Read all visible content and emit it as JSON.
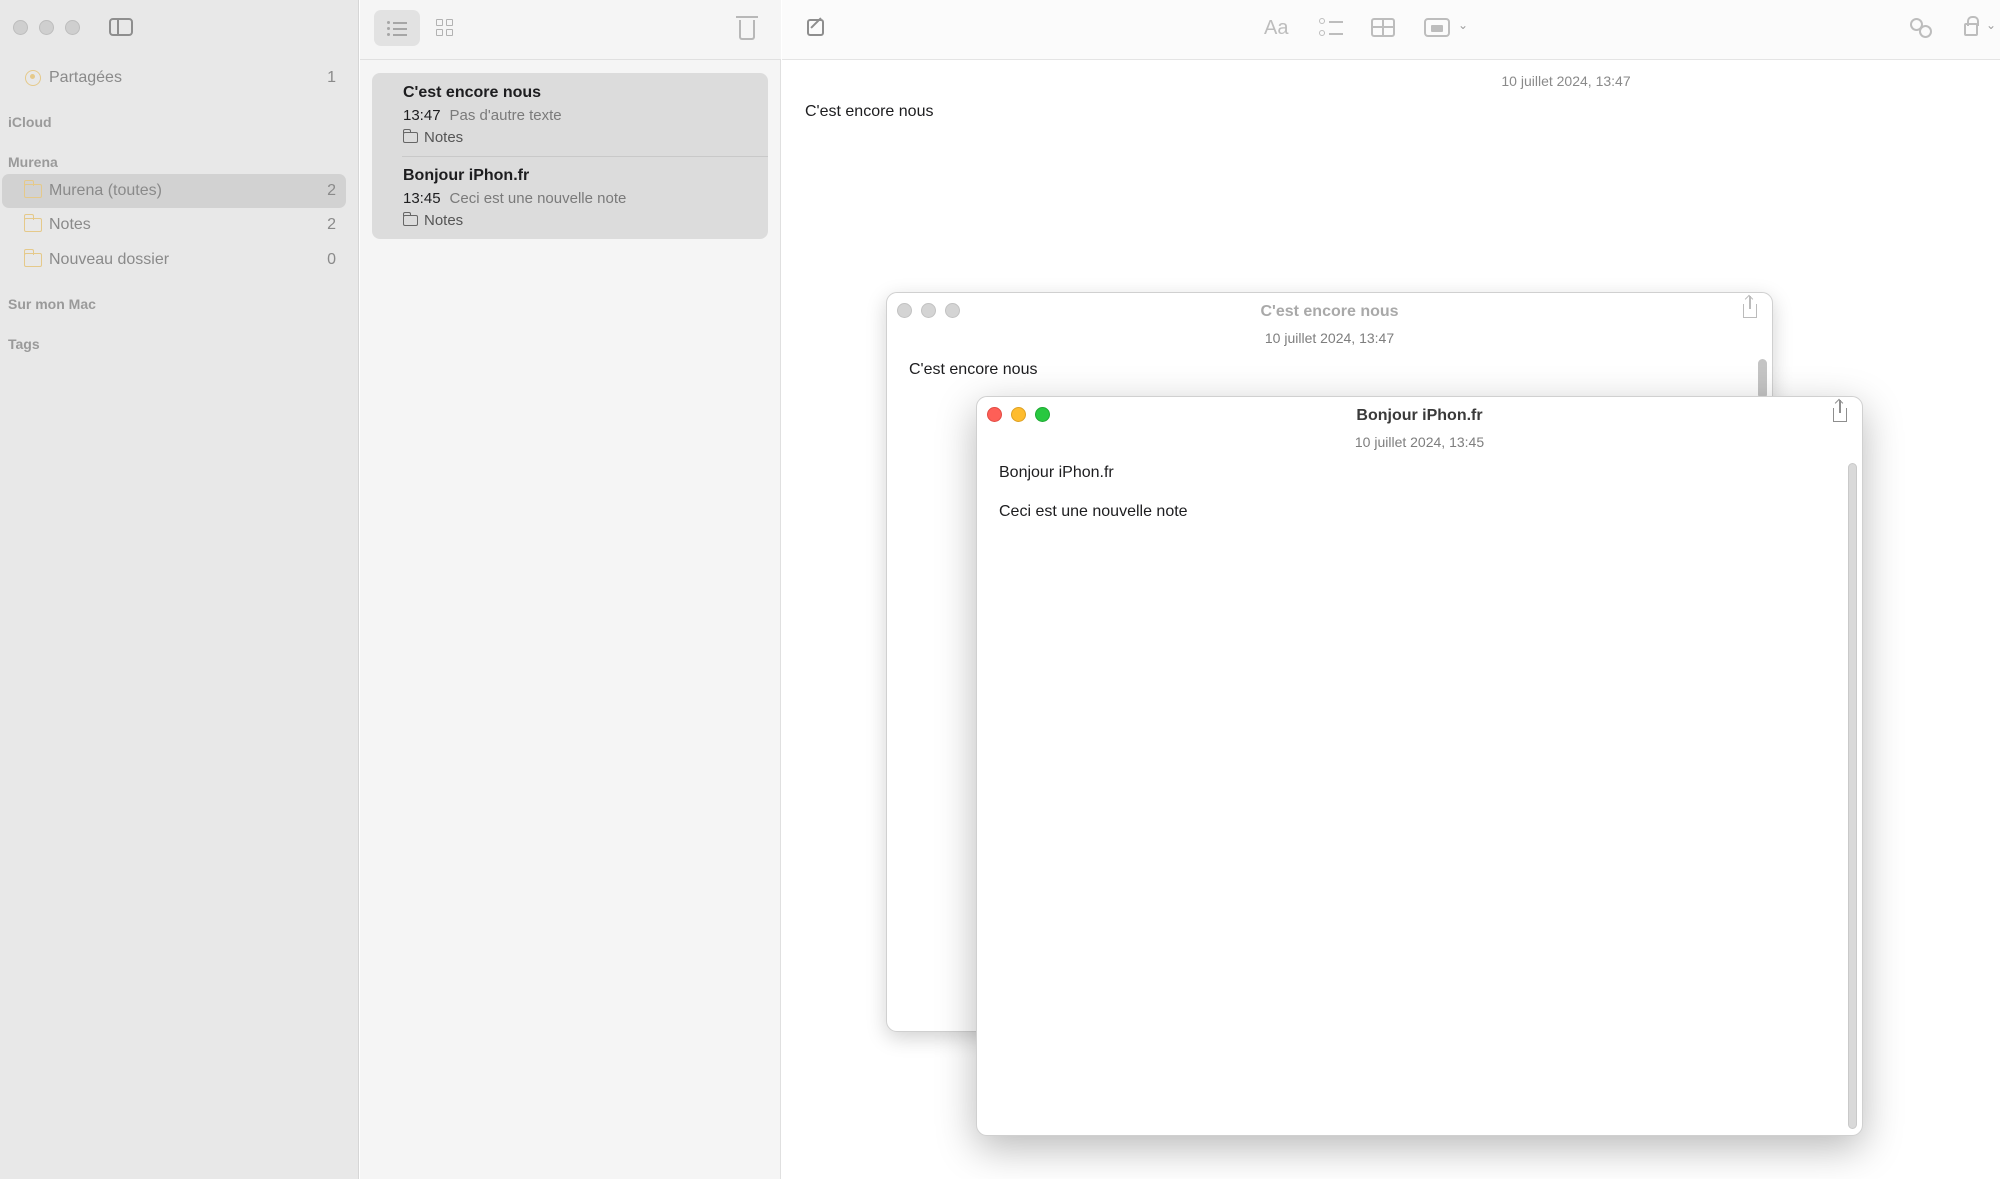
{
  "sidebar": {
    "shared": {
      "label": "Partagées",
      "count": "1"
    },
    "sections": {
      "icloud": "iCloud",
      "murena": "Murena",
      "on_mac": "Sur mon Mac",
      "tags": "Tags"
    },
    "folders": [
      {
        "label": "Murena (toutes)",
        "count": "2",
        "selected": true
      },
      {
        "label": "Notes",
        "count": "2"
      },
      {
        "label": "Nouveau dossier",
        "count": "0"
      }
    ]
  },
  "notes": [
    {
      "title": "C'est encore nous",
      "time": "13:47",
      "preview": "Pas d'autre texte",
      "folder": "Notes"
    },
    {
      "title": "Bonjour iPhon.fr",
      "time": "13:45",
      "preview": "Ceci est une nouvelle note",
      "folder": "Notes"
    }
  ],
  "toolbar": {
    "format_label": "Aa"
  },
  "editor": {
    "date": "10 juillet 2024, 13:47",
    "body": "C'est encore nous"
  },
  "window_back": {
    "title": "C'est encore nous",
    "date": "10 juillet 2024, 13:47",
    "body": "C'est encore nous"
  },
  "window_front": {
    "title": "Bonjour iPhon.fr",
    "date": "10 juillet 2024, 13:45",
    "line1": "Bonjour iPhon.fr",
    "line2": "Ceci est une nouvelle note"
  },
  "colors": {
    "close": "#fe5f57",
    "minimize": "#febc2e",
    "zoom": "#28c840",
    "folder_accent": "#e5c98a"
  }
}
